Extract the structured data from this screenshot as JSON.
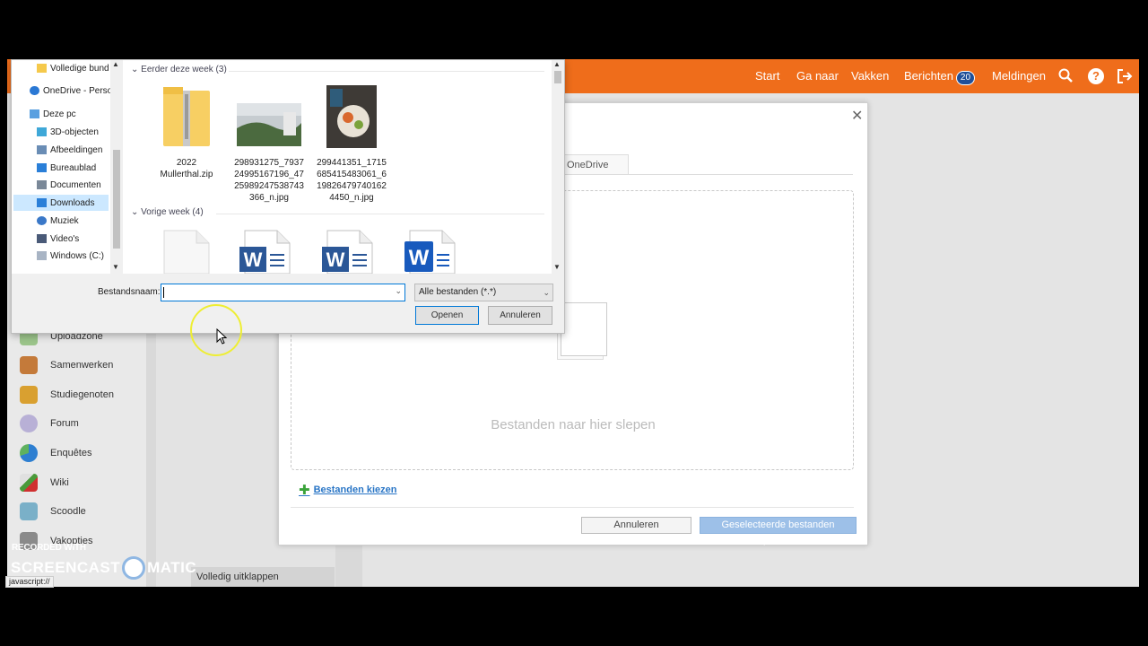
{
  "topbar": {
    "nav": [
      "Start",
      "Ga naar",
      "Vakken",
      "Berichten",
      "Meldingen"
    ],
    "message_count": "20"
  },
  "leftnav": {
    "items": [
      {
        "label": "Uploadzone",
        "icon": "upload-icon"
      },
      {
        "label": "Samenwerken",
        "icon": "handshake-icon"
      },
      {
        "label": "Studiegenoten",
        "icon": "people-icon"
      },
      {
        "label": "Forum",
        "icon": "speech-bubble-icon"
      },
      {
        "label": "Enquêtes",
        "icon": "pie-chart-icon"
      },
      {
        "label": "Wiki",
        "icon": "pencil-icon"
      },
      {
        "label": "Scoodle",
        "icon": "scoodle-icon"
      },
      {
        "label": "Vakopties",
        "icon": "wrench-icon"
      }
    ],
    "expand_all": "Volledig uitklappen"
  },
  "upload_modal": {
    "tab": "OneDrive",
    "drop_hint": "Bestanden naar hier slepen",
    "choose_files": "Bestanden kiezen",
    "cancel": "Annuleren",
    "upload": "Geselecteerde bestanden uploaden"
  },
  "file_dialog": {
    "tree": [
      {
        "label": "Volledige bund",
        "icon": "folder-icon"
      },
      {
        "label": "OneDrive - Perso",
        "icon": "cloud-icon"
      },
      {
        "label": "Deze pc",
        "icon": "computer-icon"
      },
      {
        "label": "3D-objecten",
        "icon": "cube-icon"
      },
      {
        "label": "Afbeeldingen",
        "icon": "pictures-icon"
      },
      {
        "label": "Bureaublad",
        "icon": "desktop-icon"
      },
      {
        "label": "Documenten",
        "icon": "documents-icon"
      },
      {
        "label": "Downloads",
        "icon": "download-icon"
      },
      {
        "label": "Muziek",
        "icon": "music-icon"
      },
      {
        "label": "Video's",
        "icon": "video-icon"
      },
      {
        "label": "Windows (C:)",
        "icon": "drive-icon"
      }
    ],
    "groups": [
      {
        "title": "Eerder deze week (3)"
      },
      {
        "title": "Vorige week (4)"
      }
    ],
    "files_this_week": [
      {
        "line1": "2022",
        "line2": "Mullerthal.zip",
        "line3": "",
        "line4": ""
      },
      {
        "line1": "298931275_7937",
        "line2": "24995167196_47",
        "line3": "25989247538743",
        "line4": "366_n.jpg"
      },
      {
        "line1": "299441351_1715",
        "line2": "685415483061_6",
        "line3": "19826479740162",
        "line4": "4450_n.jpg"
      }
    ],
    "filename_label": "Bestandsnaam:",
    "filename_value": "",
    "filter": "Alle bestanden (*.*)",
    "open": "Openen",
    "cancel": "Annuleren"
  },
  "overlay": {
    "recorded_with": "RECORDED WITH",
    "brand_left": "SCREENCAST",
    "brand_right": "MATIC",
    "status_url": "javascript://"
  }
}
